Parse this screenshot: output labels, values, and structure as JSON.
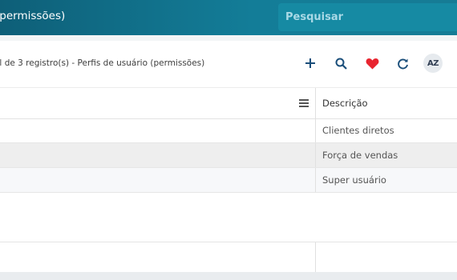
{
  "header": {
    "title": "(permissões)",
    "search_placeholder": "Pesquisar"
  },
  "toolbar": {
    "info": "al de 3 registro(s) - Perfis de usuário (permissões)",
    "sort_label": "AZ",
    "icons": [
      "add-icon",
      "search-icon",
      "favorite-heart-icon",
      "refresh-icon",
      "sort-az-icon"
    ],
    "accent_color": "#1a4e7a",
    "heart_color": "#e8242f"
  },
  "grid": {
    "column_header": "Descrição",
    "rows": [
      {
        "descricao": "Clientes diretos"
      },
      {
        "descricao": "Força de vendas"
      },
      {
        "descricao": "Super usuário"
      }
    ]
  },
  "colors": {
    "topbar": "#137d98",
    "search_bg": "#168aa3"
  }
}
